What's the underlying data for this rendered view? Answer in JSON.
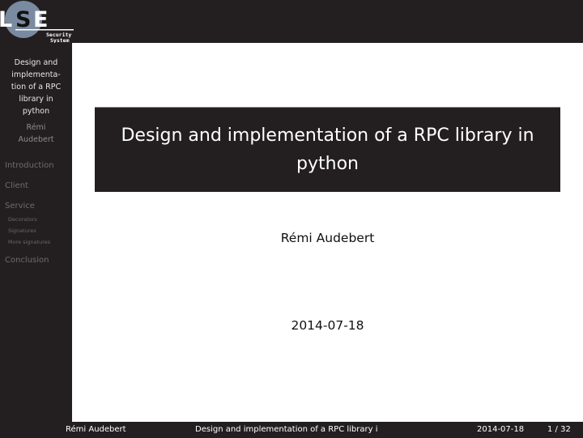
{
  "logo": {
    "letters": [
      "L",
      "S",
      "E"
    ],
    "tagline_line1": "Security",
    "tagline_line2": "System",
    "circle_color": "#7a8aa0"
  },
  "sidebar": {
    "title": "Design and implementa-tion of a RPC library in python",
    "title_lines": [
      "Design and",
      "implementa-",
      "tion of a RPC",
      "library in",
      "python"
    ],
    "author_lines": [
      "Rémi",
      "Audebert"
    ],
    "sections": [
      {
        "label": "Introduction",
        "subsections": []
      },
      {
        "label": "Client",
        "subsections": []
      },
      {
        "label": "Service",
        "subsections": [
          "Decorators",
          "Signatures",
          "More signatures"
        ]
      },
      {
        "label": "Conclusion",
        "subsections": []
      }
    ]
  },
  "slide": {
    "title": "Design and implementation of a RPC library in python",
    "author": "Rémi Audebert",
    "date": "2014-07-18"
  },
  "footer": {
    "author": "Rémi Audebert",
    "short_title": "Design and implementation of a RPC library i",
    "date": "2014-07-18",
    "page": "1 / 32"
  },
  "colors": {
    "dark_background": "#231f20",
    "sidebar_text": "#e8e6e6",
    "sidebar_inactive": "#6f6b6b"
  }
}
